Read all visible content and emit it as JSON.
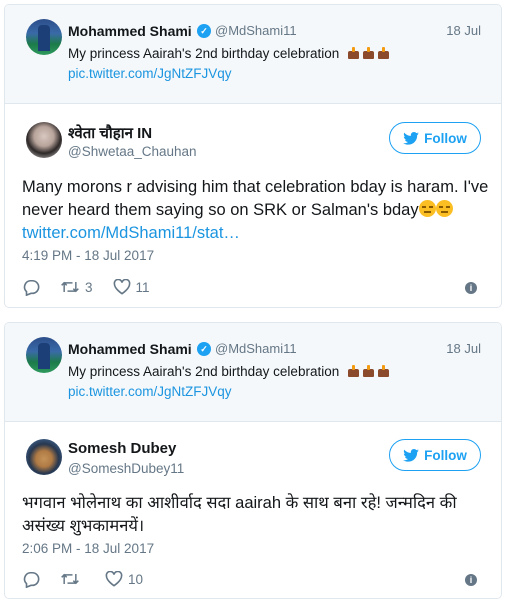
{
  "tweets": [
    {
      "quoted": {
        "name": "Mohammed Shami",
        "handle": "@MdShami11",
        "date": "18 Jul",
        "text": "My princess Aairah's 2nd birthday celebration",
        "link": "pic.twitter.com/JgNtZFJVqy"
      },
      "author": {
        "name": "श्वेता चौहान IN",
        "handle": "@Shwetaa_Chauhan"
      },
      "follow_label": "Follow",
      "text": "Many morons r advising him that celebration bday is haram. I've never heard them saying so on SRK or Salman's bday",
      "link": "twitter.com/MdShami11/stat…",
      "timestamp": "4:19 PM - 18 Jul 2017",
      "retweets": "3",
      "likes": "11"
    },
    {
      "quoted": {
        "name": "Mohammed Shami",
        "handle": "@MdShami11",
        "date": "18 Jul",
        "text": "My princess Aairah's 2nd birthday celebration",
        "link": "pic.twitter.com/JgNtZFJVqy"
      },
      "author": {
        "name": "Somesh Dubey",
        "handle": "@SomeshDubey11"
      },
      "follow_label": "Follow",
      "text": "भगवान भोलेनाथ का आशीर्वाद सदा aairah के साथ बना रहे! जन्मदिन की असंख्य शुभकामनयें।",
      "timestamp": "2:06 PM - 18 Jul 2017",
      "retweets": "",
      "likes": "10"
    }
  ],
  "colors": {
    "accent": "#1da1f2",
    "link": "#1b95e0",
    "muted": "#657786",
    "quote_bg": "#f5f8fa"
  },
  "icons": [
    "verified-badge-icon",
    "birthday-cake-icon",
    "twitter-bird-icon",
    "reply-icon",
    "retweet-icon",
    "like-icon",
    "info-icon",
    "expressionless-face-icon"
  ]
}
